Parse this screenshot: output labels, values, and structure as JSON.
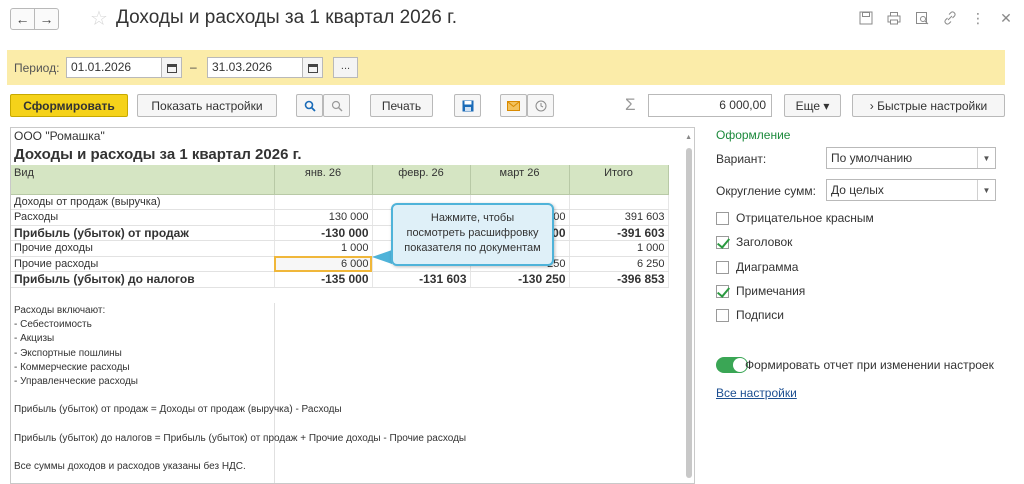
{
  "window": {
    "title": "Доходы и расходы за 1 квартал 2026 г."
  },
  "period": {
    "label": "Период:",
    "date_from": "01.01.2026",
    "separator": "–",
    "date_to": "31.03.2026",
    "more_label": "..."
  },
  "toolbar": {
    "generate_label": "Сформировать",
    "show_settings_label": "Показать настройки",
    "print_label": "Печать",
    "sigma_label": "Σ",
    "sum_value": "6 000,00",
    "more_label": "Еще ▾",
    "quick_settings_label": "› Быстрые настройки"
  },
  "report": {
    "org": "ООО \"Ромашка\"",
    "title": "Доходы и расходы за 1 квартал 2026 г.",
    "headers": [
      "Вид",
      "янв. 26",
      "февр. 26",
      "март 26",
      "Итого"
    ],
    "rows": [
      {
        "name": "Доходы от продаж (выручка)",
        "jan": "",
        "feb": "",
        "mar": "",
        "total": "",
        "bold": false
      },
      {
        "name": "Расходы",
        "jan": "130 000",
        "feb": "",
        "mar": "00",
        "total": "391 603",
        "bold": false
      },
      {
        "name": "Прибыль (убыток) от продаж",
        "jan": "-130 000",
        "feb": "",
        "mar": "00",
        "total": "-391 603",
        "bold": true
      },
      {
        "name": "Прочие доходы",
        "jan": "1 000",
        "feb": "",
        "mar": "",
        "total": "1 000",
        "bold": false
      },
      {
        "name": "Прочие расходы",
        "jan": "6 000",
        "feb": "",
        "mar": "250",
        "total": "6 250",
        "bold": false
      },
      {
        "name": "Прибыль (убыток) до налогов",
        "jan": "-135 000",
        "feb": "-131 603",
        "mar": "-130 250",
        "total": "-396 853",
        "bold": true
      }
    ],
    "notes": [
      "Расходы включают:",
      "- Себестоимость",
      "- Акцизы",
      "- Экспортные пошлины",
      "- Коммерческие расходы",
      "- Управленческие расходы",
      "",
      "Прибыль (убыток) от продаж = Доходы от продаж (выручка) - Расходы",
      "",
      "Прибыль (убыток) до налогов = Прибыль (убыток) от продаж + Прочие доходы - Прочие расходы",
      "",
      "Все суммы доходов и расходов указаны без НДС."
    ],
    "tooltip_lines": [
      "Нажмите, чтобы",
      "посмотреть расшифровку",
      "показателя по документам"
    ]
  },
  "settings": {
    "section_title": "Оформление",
    "variant_label": "Вариант:",
    "variant_value": "По умолчанию",
    "rounding_label": "Округление сумм:",
    "rounding_value": "До целых",
    "checkboxes": [
      {
        "label": "Отрицательное красным",
        "checked": false
      },
      {
        "label": "Заголовок",
        "checked": true
      },
      {
        "label": "Диаграмма",
        "checked": false
      },
      {
        "label": "Примечания",
        "checked": true
      },
      {
        "label": "Подписи",
        "checked": false
      }
    ],
    "toggle_label": "Формировать отчет при изменении настроек",
    "toggle_on": true,
    "all_settings_label": "Все настройки"
  },
  "colors": {
    "period_bar_bg": "#fbeca9",
    "primary_button": "#f5d21a",
    "table_header_bg": "#d5e5c3",
    "section_title": "#1c8a3c",
    "toggle_on": "#3aa655",
    "tooltip_border": "#4fb3d9",
    "link": "#1d4f91"
  }
}
